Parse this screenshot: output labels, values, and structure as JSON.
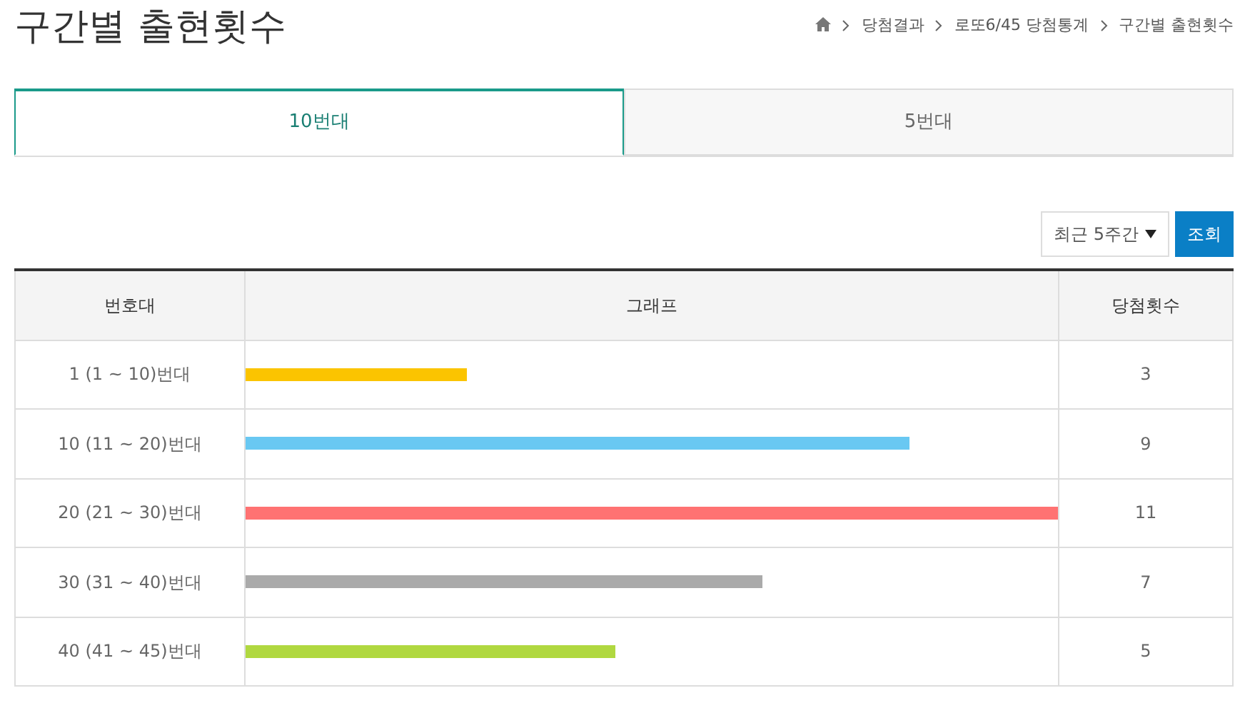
{
  "page_title": "구간별 출현횟수",
  "breadcrumb": [
    "당첨결과",
    "로또6/45 당첨통계",
    "구간별 출현횟수"
  ],
  "tabs": [
    {
      "label": "10번대",
      "selected": true
    },
    {
      "label": "5번대",
      "selected": false
    }
  ],
  "filter": {
    "period": "최근 5주간",
    "button": "조회"
  },
  "table": {
    "columns": [
      "번호대",
      "그래프",
      "당첨횟수"
    ],
    "rows": [
      {
        "range": "1 (1 ~ 10)번대",
        "level": 0.273,
        "color": "#fbc400",
        "count": "3"
      },
      {
        "range": "10 (11 ~ 20)번대",
        "level": 0.818,
        "color": "#69c8f2",
        "count": "9"
      },
      {
        "range": "20 (21 ~ 30)번대",
        "level": 1,
        "color": "#ff7272",
        "count": "11"
      },
      {
        "range": "30 (31 ~ 40)번대",
        "level": 0.636,
        "color": "#aaaaaa",
        "count": "7"
      },
      {
        "range": "40 (41 ~ 45)번대",
        "level": 0.455,
        "color": "#b0d840",
        "count": "5"
      }
    ]
  }
}
